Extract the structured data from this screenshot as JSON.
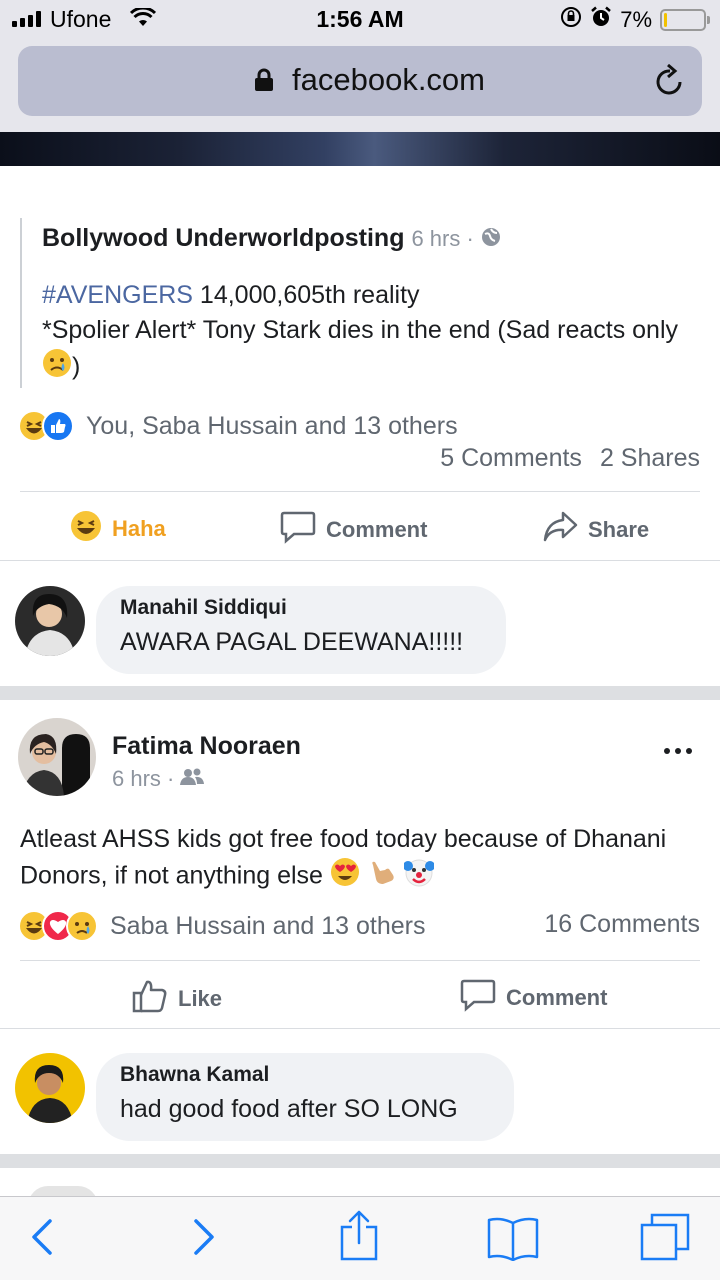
{
  "status_bar": {
    "carrier": "Ufone",
    "time": "1:56 AM",
    "battery": "7%",
    "battery_level": 0.07
  },
  "browser": {
    "url": "facebook.com",
    "lock_icon": "lock-icon",
    "reload_icon": "reload-icon"
  },
  "shared_post": {
    "author": "Bollywood Underworldposting",
    "meta": "6 hrs ·",
    "hashtag": "#AVENGERS",
    "line1_rest": " 14,000,605th reality",
    "line2": "*Spolier Alert* Tony Stark dies in the end (Sad reacts only ",
    "line2_end": ")"
  },
  "post1": {
    "reactions_text": "You, Saba Hussain and 13 others",
    "comments_count": "5 Comments",
    "shares_count": "2 Shares",
    "actions": {
      "haha": "Haha",
      "comment": "Comment",
      "share": "Share"
    },
    "comment": {
      "name": "Manahil Siddiqui",
      "text": "AWARA PAGAL DEEWANA!!!!!"
    }
  },
  "post2": {
    "author": "Fatima Nooraen",
    "meta": "6 hrs ·",
    "text": "Atleast AHSS kids got free food today because of Dhanani Donors, if not anything else ",
    "reactions_text": "Saba Hussain and 13 others",
    "comments_count": "16 Comments",
    "actions": {
      "like": "Like",
      "comment": "Comment"
    },
    "comment": {
      "name": "Bhawna Kamal",
      "text": "had good food after SO LONG"
    }
  },
  "colors": {
    "fb_blue": "#1877f2",
    "hashtag": "#4b67a1",
    "haha": "#f0a020",
    "ios_blue": "#1a7cf5"
  }
}
